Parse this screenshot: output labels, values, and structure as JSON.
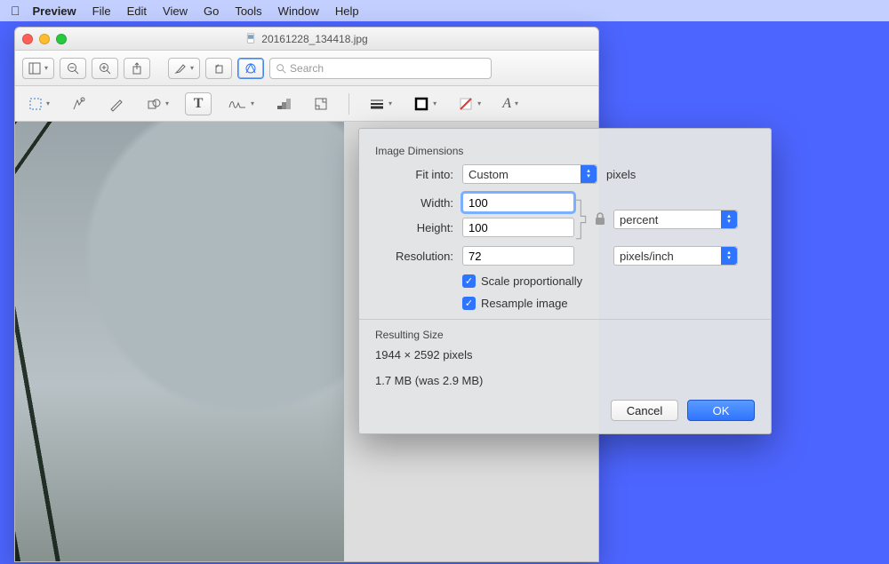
{
  "menubar": {
    "app": "Preview",
    "items": [
      "File",
      "Edit",
      "View",
      "Go",
      "Tools",
      "Window",
      "Help"
    ]
  },
  "window": {
    "title": "20161228_134418.jpg",
    "search_placeholder": "Search"
  },
  "dialog": {
    "group1_title": "Image Dimensions",
    "fit_into_label": "Fit into:",
    "fit_into_value": "Custom",
    "fit_into_unit": "pixels",
    "width_label": "Width:",
    "width_value": "100",
    "height_label": "Height:",
    "height_value": "100",
    "wh_unit": "percent",
    "resolution_label": "Resolution:",
    "resolution_value": "72",
    "resolution_unit": "pixels/inch",
    "scale_label": "Scale proportionally",
    "resample_label": "Resample image",
    "group2_title": "Resulting Size",
    "result_size": "1944 × 2592 pixels",
    "result_file": "1.7 MB (was 2.9 MB)",
    "cancel": "Cancel",
    "ok": "OK"
  }
}
